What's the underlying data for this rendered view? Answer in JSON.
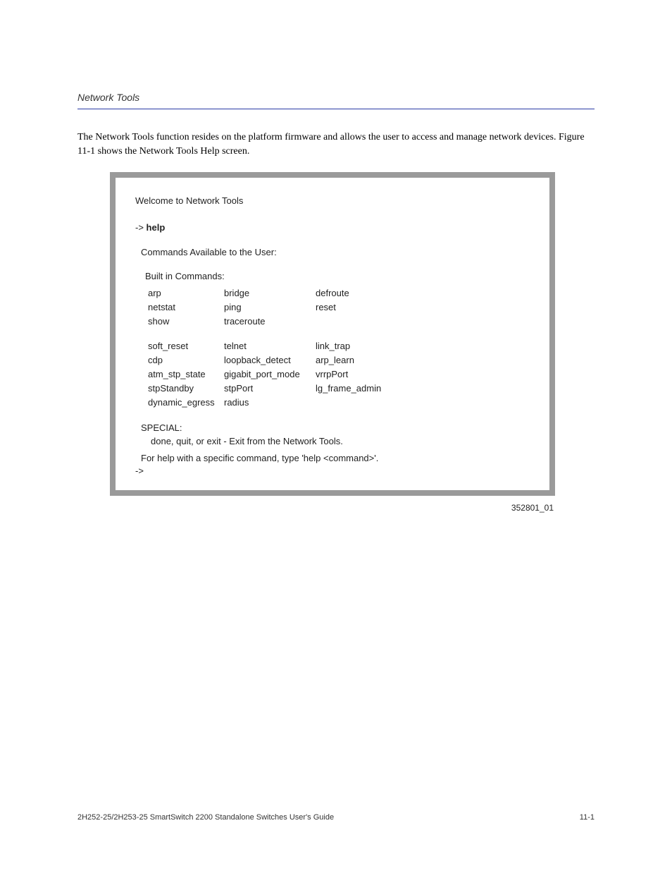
{
  "header": {
    "section_title": "Network Tools"
  },
  "paragraphs": {
    "intro": "The Network Tools function resides on the platform firmware and allows the user to access and manage network devices. Figure 11-1 shows the Network Tools Help screen."
  },
  "terminal": {
    "welcome": "Welcome to Network Tools",
    "prompt": "->",
    "command": "help",
    "avail_header": "Commands Available to the User:",
    "builtin_header": "Built in Commands:",
    "commands_block1": [
      [
        "arp",
        "bridge",
        "defroute"
      ],
      [
        "netstat",
        "ping",
        "reset"
      ],
      [
        "show",
        "traceroute",
        ""
      ]
    ],
    "commands_block2": [
      [
        "soft_reset",
        "telnet",
        "link_trap"
      ],
      [
        "cdp",
        "loopback_detect",
        "arp_learn"
      ],
      [
        "atm_stp_state",
        "gigabit_port_mode",
        "vrrpPort"
      ],
      [
        "stpStandby",
        "stpPort",
        "lg_frame_admin"
      ],
      [
        "dynamic_egress",
        "radius",
        ""
      ]
    ],
    "special_label": "SPECIAL:",
    "special_text": "done, quit, or exit - Exit from the Network Tools.",
    "help_hint": "For help with a specific command, type 'help <command>'.",
    "final_prompt": "->"
  },
  "figure": {
    "id": "352801_01"
  },
  "footer": {
    "left": "2H252-25/2H253-25 SmartSwitch 2200 Standalone Switches User's Guide",
    "right": "11-1"
  }
}
